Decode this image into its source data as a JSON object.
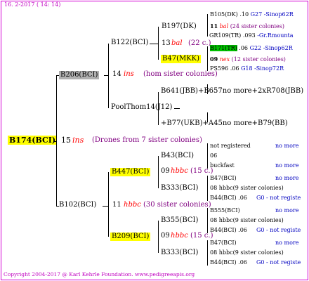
{
  "header": {
    "date": "16. 2-2017 ( 14: 14)"
  },
  "footer": {
    "text": "Copyright 2004-2017 @ Karl Kehrle Foundation.   www.pedigreeapis.org"
  },
  "root": {
    "name": "B174(BCI)",
    "year": "15",
    "ins": "ins",
    "note": "(Drones from 7 sister colonies)"
  },
  "upper": {
    "parent": "B206(BCI)",
    "year": "14",
    "ins": "ins",
    "note": "(hom sister colonies)",
    "gp1": {
      "name": "B122(BCI)",
      "year": "13",
      "ins": "bal",
      "note": "(22 c.)"
    },
    "gp2": {
      "name": "PoolThom14(J12)"
    },
    "g1": "B197(DK)",
    "g2": "B47(MKK)",
    "g3": "B641(JBB)+B657no more+2xR708(JBB)",
    "g4": "+B77(UKB)+A45no more+B79(BB)",
    "r1": {
      "name": "B105(DK)",
      "year": ".10",
      "code": "G27 -Sinop62R"
    },
    "r2": {
      "year": "11",
      "ins": "bal",
      "note": "(24 sister colonies)"
    },
    "r3": {
      "name": "GR109(TR)",
      "year": ".093",
      "code": "-Gr.Rmounta"
    },
    "r4": {
      "name": "B171(TR)",
      "year": ".06",
      "code": "G22 -Sinop62R"
    },
    "r5": {
      "year": "09",
      "ins": "nex",
      "note": "(12 sister colonies)"
    },
    "r6": {
      "name": "PS596",
      "year": ".06",
      "code": "G18 -Sinop72R"
    }
  },
  "lower": {
    "parent": "B102(BCI)",
    "year": "11",
    "ins": "hbbc",
    "note": "(30 sister colonies)",
    "gp1": {
      "name": "B447(BCI)",
      "year": "09",
      "ins": "hbbc",
      "note": "(15 c.)"
    },
    "gp2": {
      "name": "B209(BCI)",
      "year": "09",
      "ins": "hbbc",
      "note": "(15 c.)"
    },
    "g1": "B43(BCI)",
    "g2": "B333(BCI)",
    "g3": "B355(BCI)",
    "g4": "B333(BCI)",
    "rows": [
      {
        "a": "not registered",
        "b": "no more"
      },
      {
        "a": "06",
        "b": ""
      },
      {
        "a": "buckfast",
        "b": "no more"
      },
      {
        "a": "B47(BCI)",
        "b": "no more"
      },
      {
        "a": "08 hbbc(9 sister colonies)",
        "b": ""
      },
      {
        "a": "B44(BCI) .06",
        "b": "G0 - not registe"
      },
      {
        "a": "B555(BCI)",
        "b": "no more"
      },
      {
        "a": "08 hbbc(9 sister colonies)",
        "b": ""
      },
      {
        "a": "B44(BCI) .06",
        "b": "G0 - not registe"
      },
      {
        "a": "B47(BCI)",
        "b": "no more"
      },
      {
        "a": "08 hbbc(9 sister colonies)",
        "b": ""
      },
      {
        "a": "B44(BCI) .06",
        "b": "G0 - not registe"
      }
    ]
  }
}
